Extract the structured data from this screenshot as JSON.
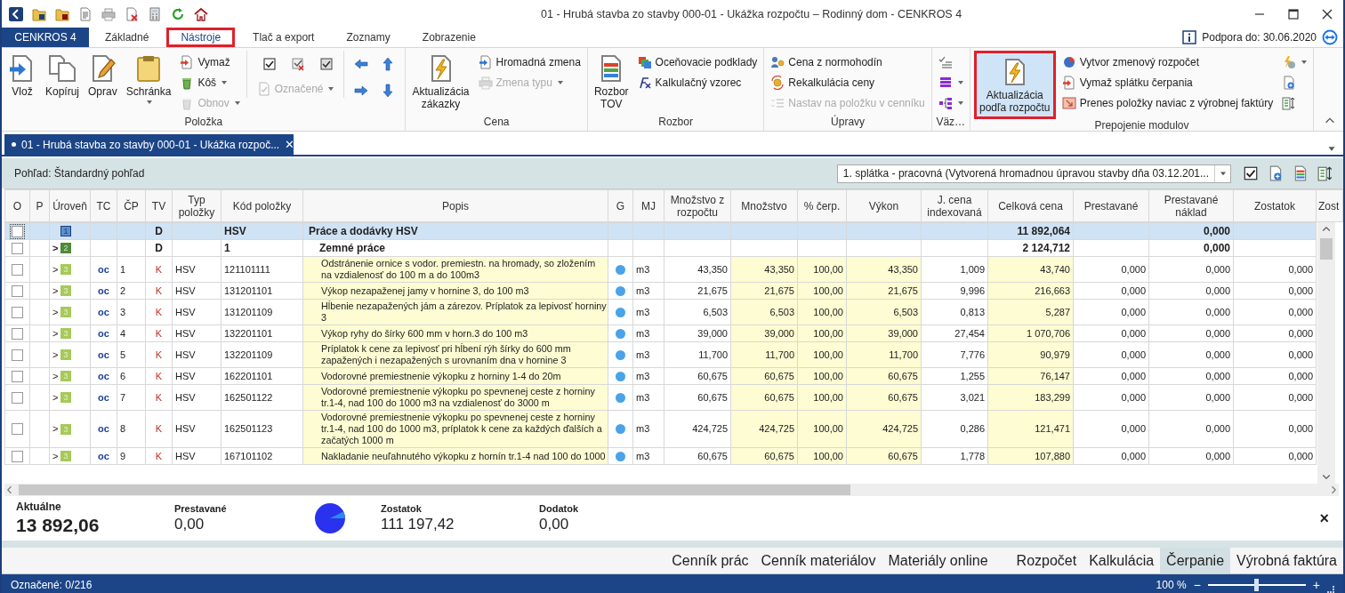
{
  "window": {
    "title": "01 - Hrubá stavba  zo stavby 000-01 - Ukážka rozpočtu – Rodinný dom -  CENKROS 4"
  },
  "app_button": "CENKROS 4",
  "tabs": [
    {
      "label": "Základné",
      "selected": false,
      "highlighted": false
    },
    {
      "label": "Nástroje",
      "selected": true,
      "highlighted": true
    },
    {
      "label": "Tlač a export",
      "selected": false,
      "highlighted": false
    },
    {
      "label": "Zoznamy",
      "selected": false,
      "highlighted": false
    },
    {
      "label": "Zobrazenie",
      "selected": false,
      "highlighted": false
    }
  ],
  "support": "Podpora do: 30.06.2020",
  "ribbon": [
    {
      "label": "Položka",
      "columns": [
        {
          "kind": "large",
          "label": "Vlož"
        },
        {
          "kind": "large",
          "label": "Kopíruj"
        },
        {
          "kind": "large",
          "label": "Oprav"
        },
        {
          "kind": "large",
          "label": "Schránka",
          "caret": true
        },
        {
          "kind": "stack",
          "items": [
            {
              "label": "Vymaž",
              "disabled": false,
              "caret": false
            },
            {
              "label": "Kôš",
              "disabled": false,
              "caret": true
            },
            {
              "label": "Obnov",
              "disabled": true,
              "caret": true
            }
          ]
        },
        {
          "kind": "checks",
          "items": [
            {
              "label": "Označené",
              "disabled": true,
              "caret": true
            }
          ]
        },
        {
          "kind": "arrows"
        }
      ]
    },
    {
      "label": "Cena",
      "columns": [
        {
          "kind": "large",
          "label": "Aktualizácia zákazky"
        },
        {
          "kind": "stack",
          "items": [
            {
              "label": "Hromadná zmena",
              "disabled": false,
              "caret": false
            },
            {
              "label": "Zmena typu",
              "disabled": true,
              "caret": true
            }
          ]
        }
      ]
    },
    {
      "label": "Rozbor",
      "columns": [
        {
          "kind": "large",
          "label": "Rozbor TOV"
        },
        {
          "kind": "stack",
          "items": [
            {
              "label": "Oceňovacie podklady",
              "disabled": false,
              "caret": false
            },
            {
              "label": "Kalkulačný vzorec",
              "disabled": false,
              "caret": false
            }
          ]
        }
      ]
    },
    {
      "label": "Úpravy",
      "columns": [
        {
          "kind": "stack",
          "items": [
            {
              "label": "Cena z normohodín",
              "disabled": false,
              "caret": false
            },
            {
              "label": "Rekalkulácia ceny",
              "disabled": false,
              "caret": false
            },
            {
              "label": "Nastav na položku v cenníku",
              "disabled": true,
              "caret": false
            }
          ]
        }
      ]
    },
    {
      "label": "Väz…",
      "columns": [
        {
          "kind": "stack",
          "items": [
            {
              "disabled": false,
              "caret": false
            },
            {
              "disabled": false,
              "caret": true
            },
            {
              "disabled": false,
              "caret": true
            }
          ]
        }
      ]
    },
    {
      "label": "Prepojenie modulov",
      "columns": [
        {
          "kind": "large",
          "label": "Aktualizácia podľa rozpočtu",
          "highlighted": true
        },
        {
          "kind": "stack",
          "items": [
            {
              "label": "Vytvor zmenový rozpočet",
              "disabled": false,
              "caret": false
            },
            {
              "label": "Vymaž splátku čerpania",
              "disabled": false,
              "caret": false
            },
            {
              "label": "Prenes položky naviac z výrobnej faktúry",
              "disabled": false,
              "caret": false
            }
          ]
        },
        {
          "kind": "stack",
          "items": [
            {
              "disabled": false,
              "caret": true
            },
            {
              "disabled": false,
              "caret": false
            },
            {
              "disabled": false,
              "caret": false
            }
          ]
        }
      ]
    }
  ],
  "document_tab": {
    "title": "01 - Hrubá stavba  zo stavby 000-01 - Ukážka rozpoč...",
    "close": "✕"
  },
  "view": {
    "label": "Pohľad: Štandardný pohľad",
    "installment": "1. splátka - pracovná (Vytvorená hromadnou úpravou stavby dňa 03.12.201..."
  },
  "table": {
    "columns": [
      "O",
      "P",
      "Úroveň",
      "TC",
      "ČP",
      "TV",
      "Typ položky",
      "Kód položky",
      "Popis",
      "G",
      "MJ",
      "Množstvo z rozpočtu",
      "Množstvo",
      "% čerp.",
      "Výkon",
      "J. cena indexovaná",
      "Celková cena",
      "Prestavané",
      "Prestavané náklad",
      "Zostatok",
      "Zost"
    ],
    "rows": [
      {
        "kind": "section",
        "selected": true,
        "checked": false,
        "level_badge": "1",
        "tv": "D",
        "kod": "HSV",
        "popis": "Práce a dodávky HSV",
        "celkova": "11 892,064",
        "naklad": "0,000"
      },
      {
        "kind": "subsection",
        "selected": false,
        "checked": false,
        "expander": ">",
        "level_badge": "2",
        "tv": "D",
        "kod": "1",
        "popis": "Zemné práce",
        "celkova": "2 124,712",
        "naklad": "0,000"
      },
      {
        "kind": "item",
        "selected": false,
        "checked": false,
        "expander": ">",
        "level_badge": "3",
        "tc": "oc",
        "cp": "1",
        "tv": "K",
        "typ": "HSV",
        "kod": "121101111",
        "popis": "Odstránenie ornice s vodor. premiestn. na hromady, so zložením na vzdialenosť do 100 m a do 100m3",
        "color": "#4aa3e8",
        "mj": "m3",
        "mzr": "43,350",
        "mn": "43,350",
        "cerp": "100,00",
        "vykon": "43,350",
        "jcena": "1,009",
        "celkova": "43,740",
        "prest": "0,000",
        "naklad": "0,000",
        "zost": "0,000"
      },
      {
        "kind": "item",
        "selected": false,
        "checked": false,
        "expander": ">",
        "level_badge": "3",
        "tc": "oc",
        "cp": "2",
        "tv": "K",
        "typ": "HSV",
        "kod": "131201101",
        "popis": "Výkop nezapaženej jamy v hornine 3, do 100 m3",
        "color": "#4aa3e8",
        "mj": "m3",
        "mzr": "21,675",
        "mn": "21,675",
        "cerp": "100,00",
        "vykon": "21,675",
        "jcena": "9,996",
        "celkova": "216,663",
        "prest": "0,000",
        "naklad": "0,000",
        "zost": "0,000"
      },
      {
        "kind": "item",
        "selected": false,
        "checked": false,
        "expander": ">",
        "level_badge": "3",
        "tc": "oc",
        "cp": "3",
        "tv": "K",
        "typ": "HSV",
        "kod": "131201109",
        "popis": "Hĺbenie nezapažených jám a zárezov. Príplatok za lepivosť horniny 3",
        "color": "#4aa3e8",
        "mj": "m3",
        "mzr": "6,503",
        "mn": "6,503",
        "cerp": "100,00",
        "vykon": "6,503",
        "jcena": "0,813",
        "celkova": "5,287",
        "prest": "0,000",
        "naklad": "0,000",
        "zost": "0,000"
      },
      {
        "kind": "item",
        "selected": false,
        "checked": false,
        "expander": ">",
        "level_badge": "3",
        "tc": "oc",
        "cp": "4",
        "tv": "K",
        "typ": "HSV",
        "kod": "132201101",
        "popis": "Výkop ryhy do šírky 600 mm v horn.3 do 100 m3",
        "color": "#4aa3e8",
        "mj": "m3",
        "mzr": "39,000",
        "mn": "39,000",
        "cerp": "100,00",
        "vykon": "39,000",
        "jcena": "27,454",
        "celkova": "1 070,706",
        "prest": "0,000",
        "naklad": "0,000",
        "zost": "0,000"
      },
      {
        "kind": "item",
        "selected": false,
        "checked": false,
        "expander": ">",
        "level_badge": "3",
        "tc": "oc",
        "cp": "5",
        "tv": "K",
        "typ": "HSV",
        "kod": "132201109",
        "popis": "Príplatok k cene za lepivosť pri hĺbení rýh šírky do 600 mm zapažených i nezapažených s urovnaním dna v hornine 3",
        "color": "#4aa3e8",
        "mj": "m3",
        "mzr": "11,700",
        "mn": "11,700",
        "cerp": "100,00",
        "vykon": "11,700",
        "jcena": "7,776",
        "celkova": "90,979",
        "prest": "0,000",
        "naklad": "0,000",
        "zost": "0,000"
      },
      {
        "kind": "item",
        "selected": false,
        "checked": false,
        "expander": ">",
        "level_badge": "3",
        "tc": "oc",
        "cp": "6",
        "tv": "K",
        "typ": "HSV",
        "kod": "162201101",
        "popis": "Vodorovné premiestnenie výkopku z horniny 1-4 do 20m",
        "color": "#4aa3e8",
        "mj": "m3",
        "mzr": "60,675",
        "mn": "60,675",
        "cerp": "100,00",
        "vykon": "60,675",
        "jcena": "1,255",
        "celkova": "76,147",
        "prest": "0,000",
        "naklad": "0,000",
        "zost": "0,000"
      },
      {
        "kind": "item",
        "selected": false,
        "checked": false,
        "expander": ">",
        "level_badge": "3",
        "tc": "oc",
        "cp": "7",
        "tv": "K",
        "typ": "HSV",
        "kod": "162501122",
        "popis": "Vodorovné premiestnenie výkopku po spevnenej ceste z horniny tr.1-4, nad 100 do 1000 m3 na vzdialenosť do 3000 m",
        "color": "#4aa3e8",
        "mj": "m3",
        "mzr": "60,675",
        "mn": "60,675",
        "cerp": "100,00",
        "vykon": "60,675",
        "jcena": "3,021",
        "celkova": "183,299",
        "prest": "0,000",
        "naklad": "0,000",
        "zost": "0,000"
      },
      {
        "kind": "item",
        "selected": false,
        "checked": false,
        "expander": ">",
        "level_badge": "3",
        "tc": "oc",
        "cp": "8",
        "tv": "K",
        "typ": "HSV",
        "kod": "162501123",
        "popis": "Vodorovné premiestnenie výkopku po spevnenej ceste z horniny tr.1-4, nad 100 do 1000 m3, príplatok k cene za každých ďalších a začatých 1000 m",
        "color": "#4aa3e8",
        "mj": "m3",
        "mzr": "424,725",
        "mn": "424,725",
        "cerp": "100,00",
        "vykon": "424,725",
        "jcena": "0,286",
        "celkova": "121,471",
        "prest": "0,000",
        "naklad": "0,000",
        "zost": "0,000"
      },
      {
        "kind": "item",
        "selected": false,
        "checked": false,
        "expander": ">",
        "level_badge": "3",
        "tc": "oc",
        "cp": "9",
        "tv": "K",
        "typ": "HSV",
        "kod": "167101102",
        "popis": "Nakladanie neuľahnutého výkopku z hornín tr.1-4 nad 100 do 1000",
        "color": "#4aa3e8",
        "mj": "m3",
        "mzr": "60,675",
        "mn": "60,675",
        "cerp": "100,00",
        "vykon": "60,675",
        "jcena": "1,778",
        "celkova": "107,880",
        "prest": "0,000",
        "naklad": "0,000",
        "zost": "0,000"
      }
    ]
  },
  "summary": [
    {
      "label": "Aktuálne",
      "value": "13 892,06",
      "emphasis": true
    },
    {
      "label": "Prestavané",
      "value": "0,00",
      "emphasis": false
    },
    {
      "kind": "pie"
    },
    {
      "label": "Zostatok",
      "value": "111 197,42",
      "emphasis": false
    },
    {
      "label": "Dodatok",
      "value": "0,00",
      "emphasis": false
    }
  ],
  "summary_close": "×",
  "module_tabs": [
    {
      "label": "Cenník prác",
      "selected": false
    },
    {
      "label": "Cenník materiálov",
      "selected": false
    },
    {
      "label": "Materiály online",
      "selected": false,
      "gap_after": true
    },
    {
      "label": "Rozpočet",
      "selected": false
    },
    {
      "label": "Kalkulácia",
      "selected": false
    },
    {
      "label": "Čerpanie",
      "selected": true
    },
    {
      "label": "Výrobná faktúra",
      "selected": false
    }
  ],
  "status_bar": {
    "marked": "Označené: 0/216",
    "zoom": "100 %",
    "zoom_out": "−",
    "zoom_in": "+",
    "zoom_slider": {
      "level": 0.5
    }
  }
}
